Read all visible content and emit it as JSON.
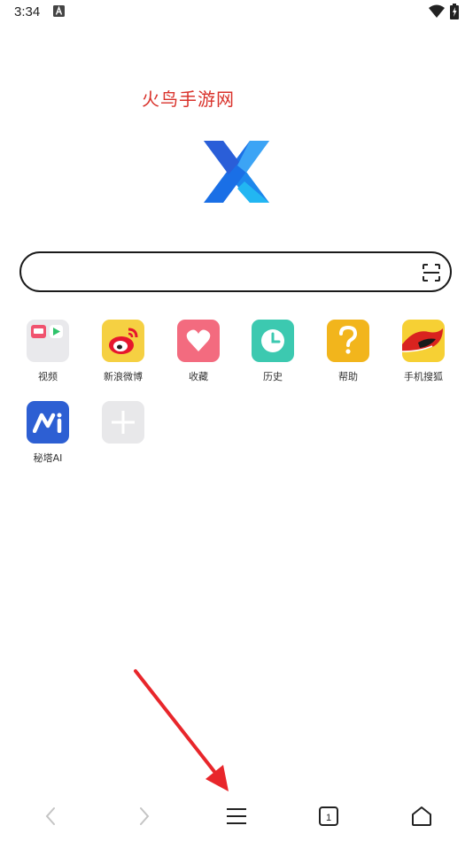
{
  "status_bar": {
    "time": "3:34"
  },
  "watermark": "火鸟手游网",
  "search": {
    "value": "",
    "placeholder": ""
  },
  "shortcuts": [
    {
      "label": "视频",
      "icon": "video-folder-icon"
    },
    {
      "label": "新浪微博",
      "icon": "weibo-icon"
    },
    {
      "label": "收藏",
      "icon": "heart-icon"
    },
    {
      "label": "历史",
      "icon": "clock-icon"
    },
    {
      "label": "帮助",
      "icon": "question-icon"
    },
    {
      "label": "手机搜狐",
      "icon": "sohu-fox-icon"
    },
    {
      "label": "秘塔AI",
      "icon": "metaso-ai-icon"
    },
    {
      "label": "",
      "icon": "add-shortcut-icon"
    }
  ],
  "bottom_nav": {
    "tab_count": "1",
    "items": [
      "back-icon",
      "forward-icon",
      "menu-icon",
      "tabs-icon",
      "home-icon"
    ]
  },
  "colors": {
    "weibo": "#f5d042",
    "favorites": "#f36b7f",
    "history": "#3cc9b0",
    "help": "#f2b51c",
    "sohu": "#f6d034",
    "metaso": "#2d5fd3",
    "annotation_arrow": "#e8262b"
  }
}
